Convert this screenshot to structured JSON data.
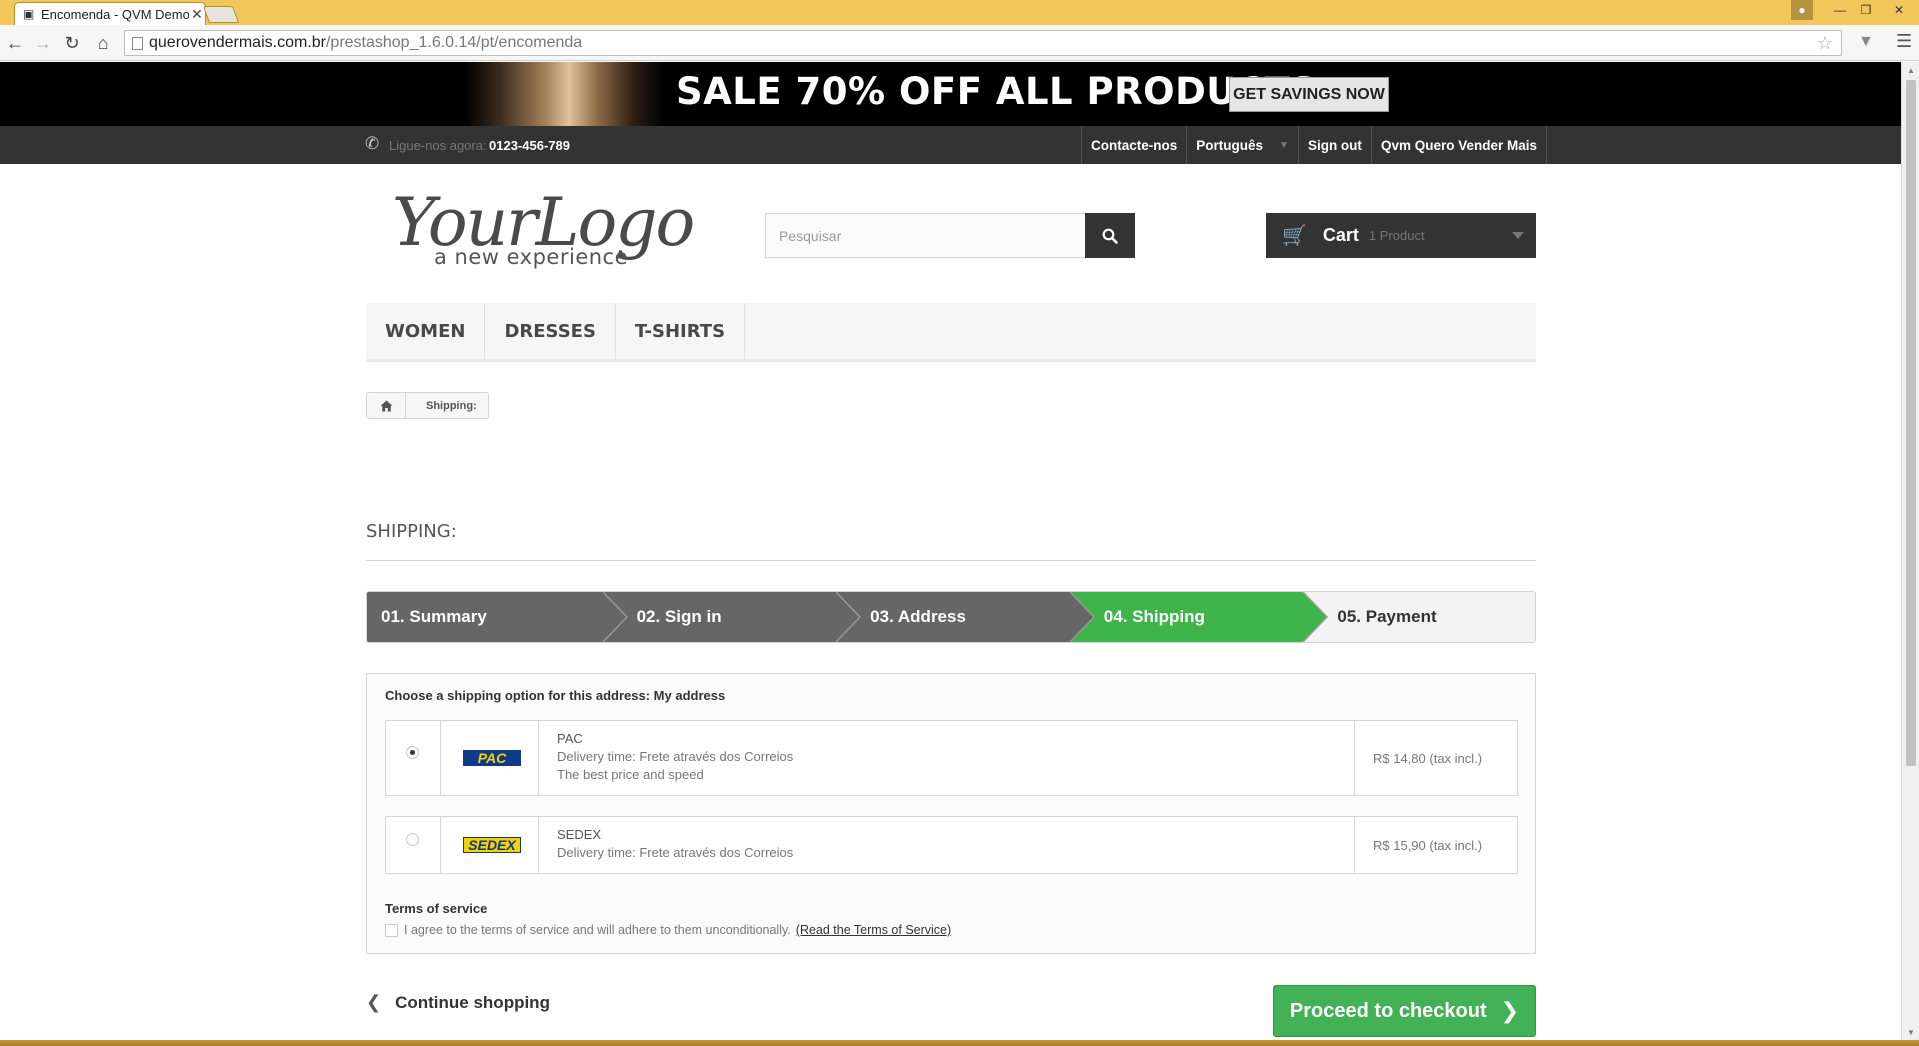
{
  "browser": {
    "tab_title": "Encomenda - QVM Demo",
    "tab_close": "✕",
    "url_host": "querovendermais.com.br",
    "url_path": "/prestashop_1.6.0.14/pt/encomenda"
  },
  "banner": {
    "text": "SALE 70% OFF ALL PRODUCTS",
    "button": "GET SAVINGS NOW"
  },
  "topnav": {
    "phone_label": "Ligue-nos agora:",
    "phone_number": "0123-456-789",
    "links": [
      "Contacte-nos",
      "Português",
      "Sign out",
      "Qvm Quero Vender Mais"
    ]
  },
  "logo": {
    "main": "YourLogo",
    "sub": "a new experience"
  },
  "search": {
    "placeholder": "Pesquisar"
  },
  "cart": {
    "label": "Cart",
    "count": "1 Product"
  },
  "menu": [
    "WOMEN",
    "DRESSES",
    "T-SHIRTS"
  ],
  "breadcrumb": {
    "current": "Shipping:"
  },
  "page_heading": "SHIPPING:",
  "steps": [
    "01. Summary",
    "02. Sign in",
    "03. Address",
    "04. Shipping",
    "05. Payment"
  ],
  "shipping": {
    "prompt": "Choose a shipping option for this address: My address",
    "carriers": [
      {
        "logo": "PAC",
        "name": "PAC",
        "delivery": "Delivery time: Frete através dos Correios",
        "extra": "The best price and speed",
        "price": "R$ 14,80 (tax incl.)",
        "selected": true
      },
      {
        "logo": "SEDEX",
        "name": "SEDEX",
        "delivery": "Delivery time: Frete através dos Correios",
        "extra": "",
        "price": "R$ 15,90 (tax incl.)",
        "selected": false
      }
    ],
    "terms_title": "Terms of service",
    "terms_text": "I agree to the terms of service and will adhere to them unconditionally.",
    "terms_link": "(Read the Terms of Service)"
  },
  "actions": {
    "continue": "Continue shopping",
    "checkout": "Proceed to checkout"
  },
  "colors": {
    "accent_green": "#43b155",
    "dark_bar": "#333333",
    "chrome_titlebar": "#f1c65a"
  }
}
